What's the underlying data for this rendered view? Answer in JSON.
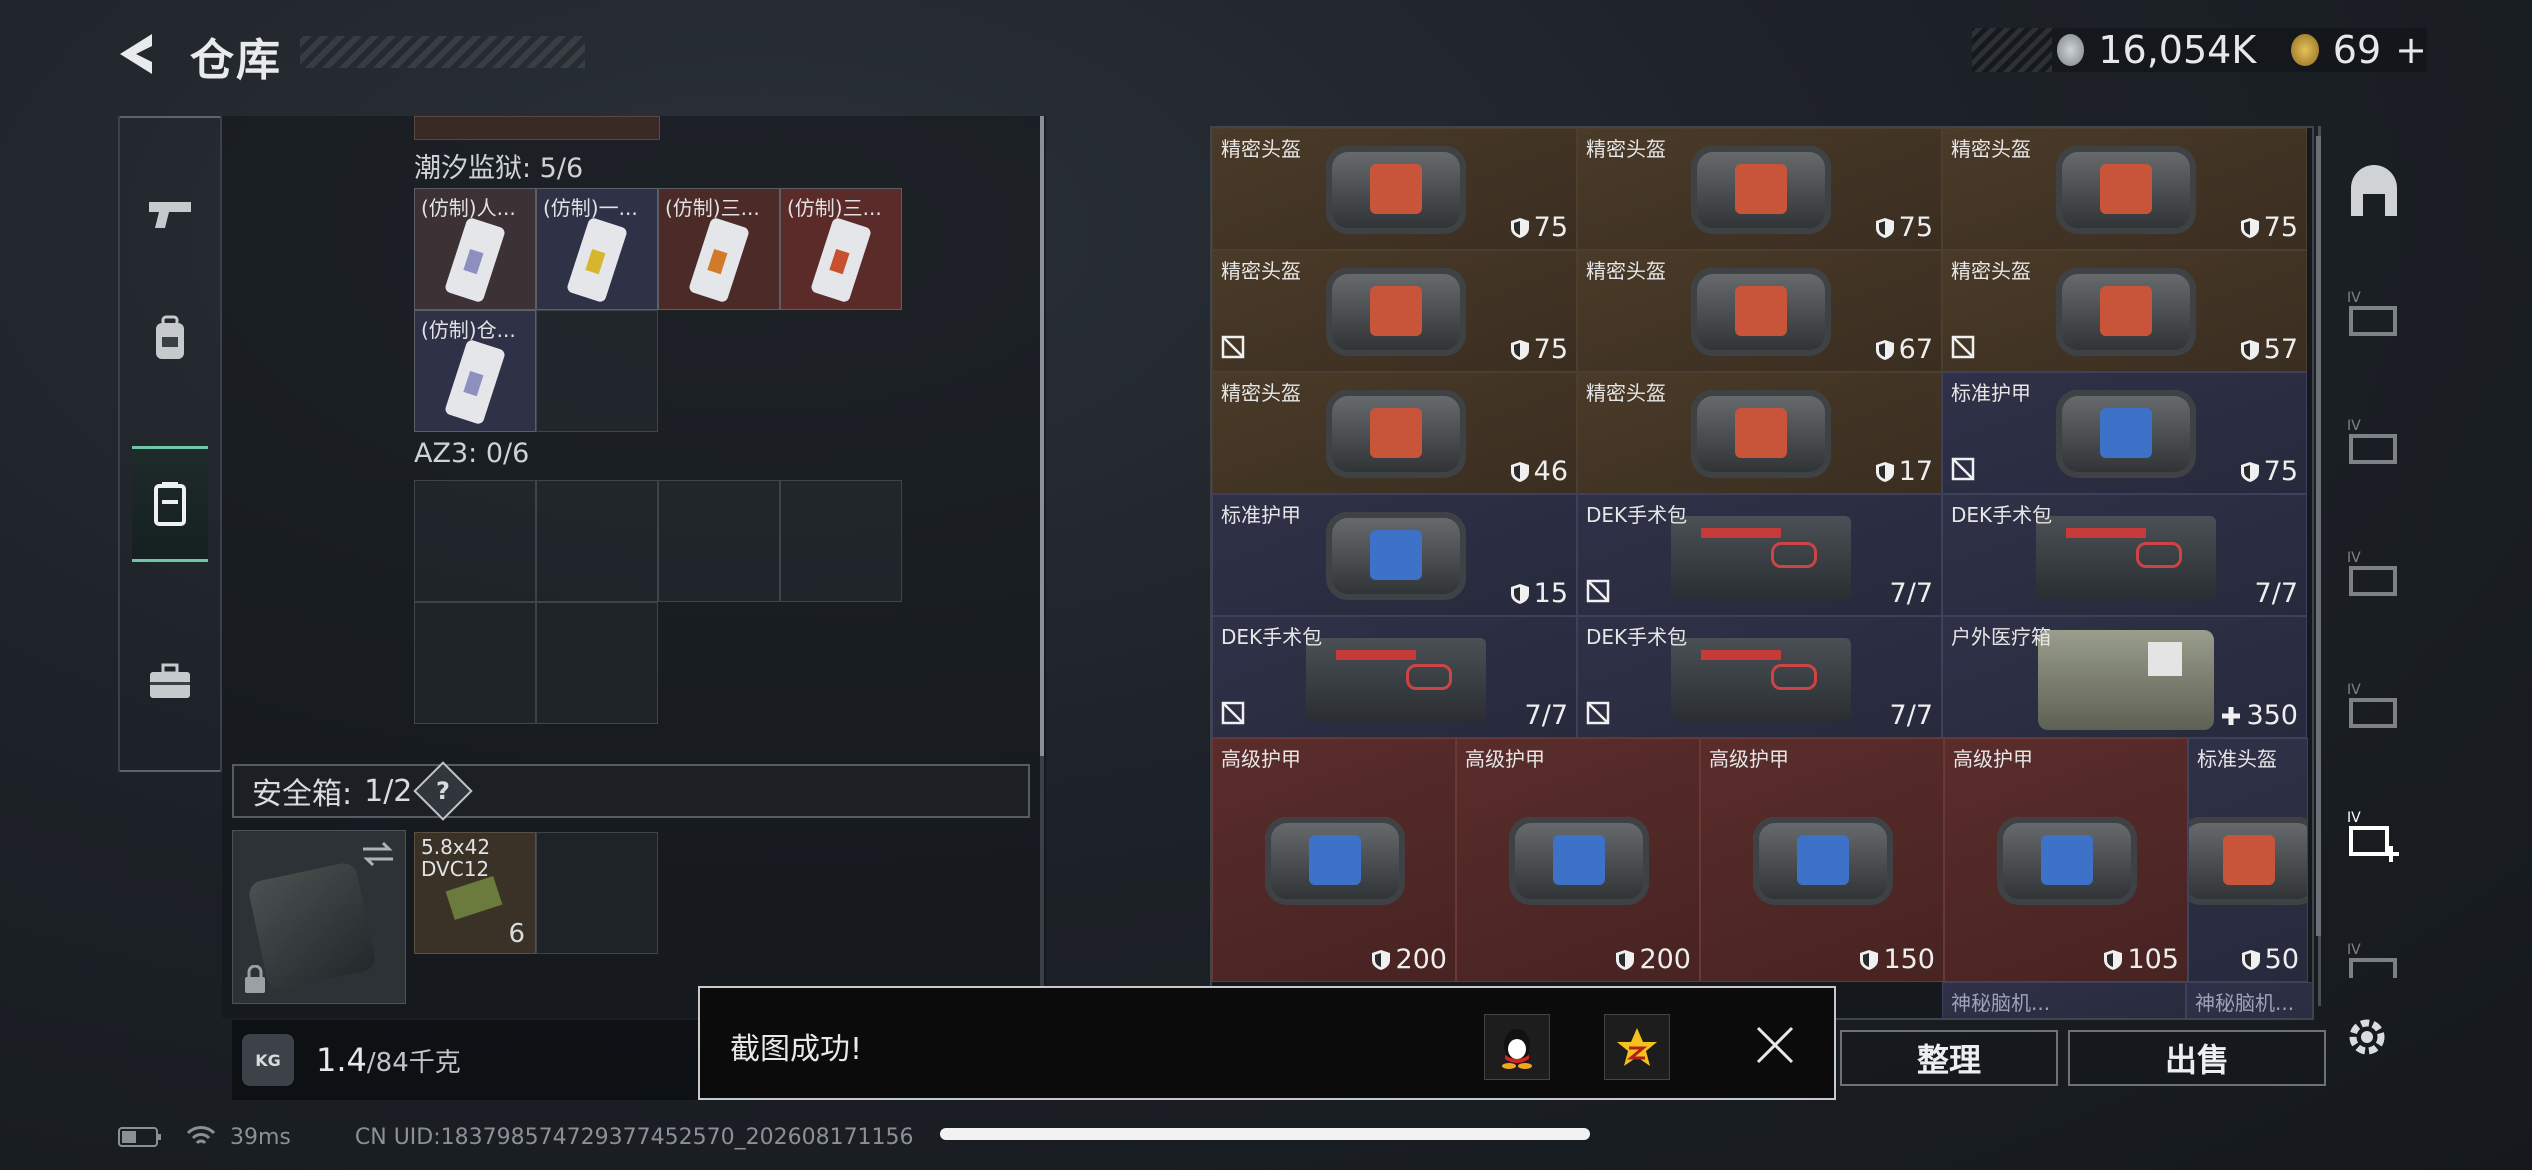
{
  "header": {
    "title": "仓库"
  },
  "currency": {
    "silver": "16,054K",
    "gold": "69",
    "add": "+"
  },
  "left": {
    "partial_top": true,
    "section1": {
      "label": "潮汐监狱: 5/6",
      "items": [
        "(仿制)人...",
        "(仿制)一...",
        "(仿制)三...",
        "(仿制)三...",
        "(仿制)仓..."
      ]
    },
    "section2": {
      "label": "AZ3: 0/6"
    },
    "safe": {
      "label": "安全箱:",
      "count": "1/2",
      "help": "?"
    },
    "ammo": {
      "name": "5.8x42 DVC12",
      "count": "6"
    },
    "weight": {
      "current": "1.4",
      "max": "/84千克",
      "icon": "KG"
    }
  },
  "grid": {
    "rows": [
      [
        {
          "n": "精密头盔",
          "v": "75",
          "c": "brown",
          "nf": false
        },
        {
          "n": "精密头盔",
          "v": "75",
          "c": "brown",
          "nf": false
        },
        {
          "n": "精密头盔",
          "v": "75",
          "c": "brown",
          "nf": false
        }
      ],
      [
        {
          "n": "精密头盔",
          "v": "75",
          "c": "brown",
          "nf": true
        },
        {
          "n": "精密头盔",
          "v": "67",
          "c": "brown",
          "nf": false
        },
        {
          "n": "精密头盔",
          "v": "57",
          "c": "brown",
          "nf": true
        }
      ],
      [
        {
          "n": "精密头盔",
          "v": "46",
          "c": "brown",
          "nf": false
        },
        {
          "n": "精密头盔",
          "v": "17",
          "c": "brown",
          "nf": false
        },
        {
          "n": "标准护甲",
          "v": "75",
          "c": "blue",
          "nf": true
        }
      ],
      [
        {
          "n": "标准护甲",
          "v": "15",
          "c": "blue",
          "nf": false
        },
        {
          "n": "DEK手术包",
          "v": "7/7",
          "c": "blue",
          "nf": true
        },
        {
          "n": "DEK手术包",
          "v": "7/7",
          "c": "blue",
          "nf": false
        }
      ],
      [
        {
          "n": "DEK手术包",
          "v": "7/7",
          "c": "blue",
          "nf": true
        },
        {
          "n": "DEK手术包",
          "v": "7/7",
          "c": "blue",
          "nf": true
        },
        {
          "n": "户外医疗箱",
          "v": "350",
          "c": "blue",
          "nf": false
        }
      ]
    ],
    "big": [
      {
        "n": "高级护甲",
        "v": "200"
      },
      {
        "n": "高级护甲",
        "v": "200"
      },
      {
        "n": "高级护甲",
        "v": "150"
      },
      {
        "n": "高级护甲",
        "v": "105"
      }
    ],
    "last": {
      "n": "标准头盔",
      "v": "50"
    },
    "peek": [
      "神秘脑机...",
      "神秘脑机...",
      "神秘脑机..."
    ]
  },
  "actions": {
    "sort": "整理",
    "sell": "出售"
  },
  "toast": {
    "message": "截图成功!"
  },
  "status": {
    "ping": "39ms",
    "uid": "CN UID:183798574729377452570_202608171156"
  }
}
